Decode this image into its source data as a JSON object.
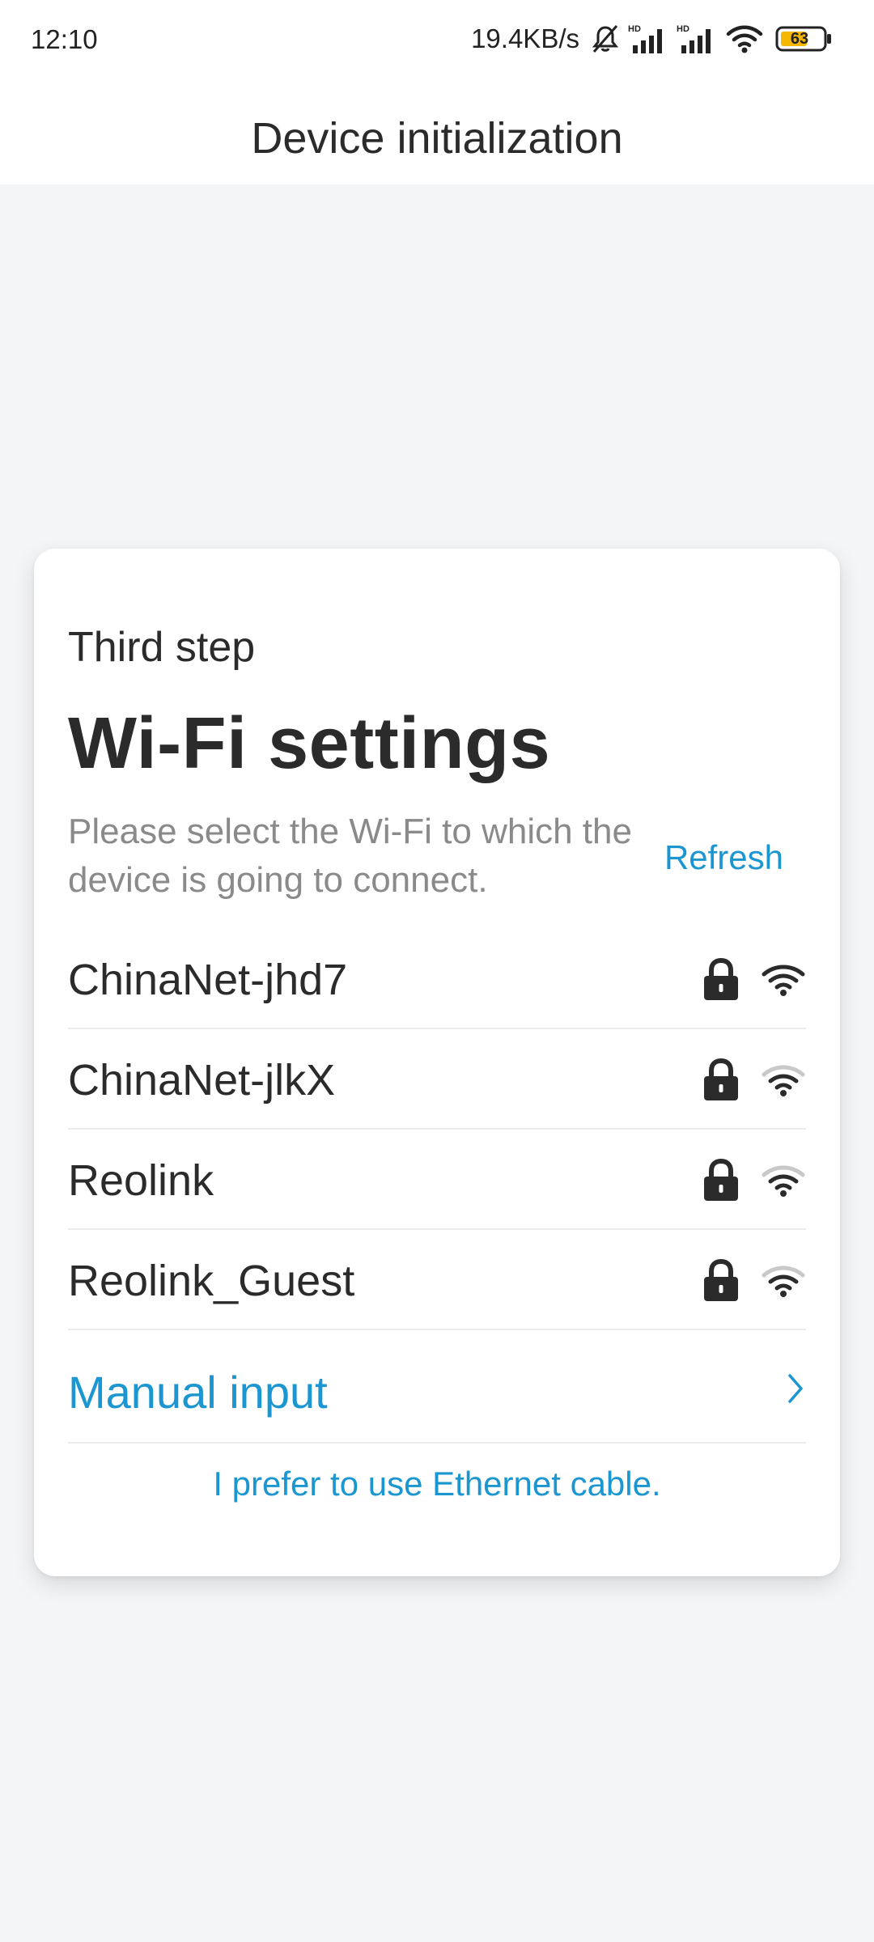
{
  "status_bar": {
    "time": "12:10",
    "net_speed": "19.4KB/s",
    "battery": "63",
    "icons": [
      "mute-icon",
      "hd-signal-icon",
      "hd-signal-icon",
      "wifi-icon",
      "battery-icon"
    ]
  },
  "header": {
    "title": "Device initialization"
  },
  "card": {
    "step": "Third step",
    "title": "Wi-Fi settings",
    "description": "Please select the Wi-Fi to which the device is going to connect.",
    "refresh_label": "Refresh",
    "networks": [
      {
        "name": "ChinaNet-jhd7",
        "secured": true,
        "signal": "full"
      },
      {
        "name": "ChinaNet-jlkX",
        "secured": true,
        "signal": "medium"
      },
      {
        "name": "Reolink",
        "secured": true,
        "signal": "medium"
      },
      {
        "name": "Reolink_Guest",
        "secured": true,
        "signal": "medium"
      }
    ],
    "manual_input_label": "Manual input",
    "ethernet_label": "I prefer to use Ethernet cable."
  },
  "colors": {
    "accent": "#1b96d1",
    "background": "#f4f5f7",
    "text": "#2b2b2b",
    "muted": "#8a8a8a"
  }
}
